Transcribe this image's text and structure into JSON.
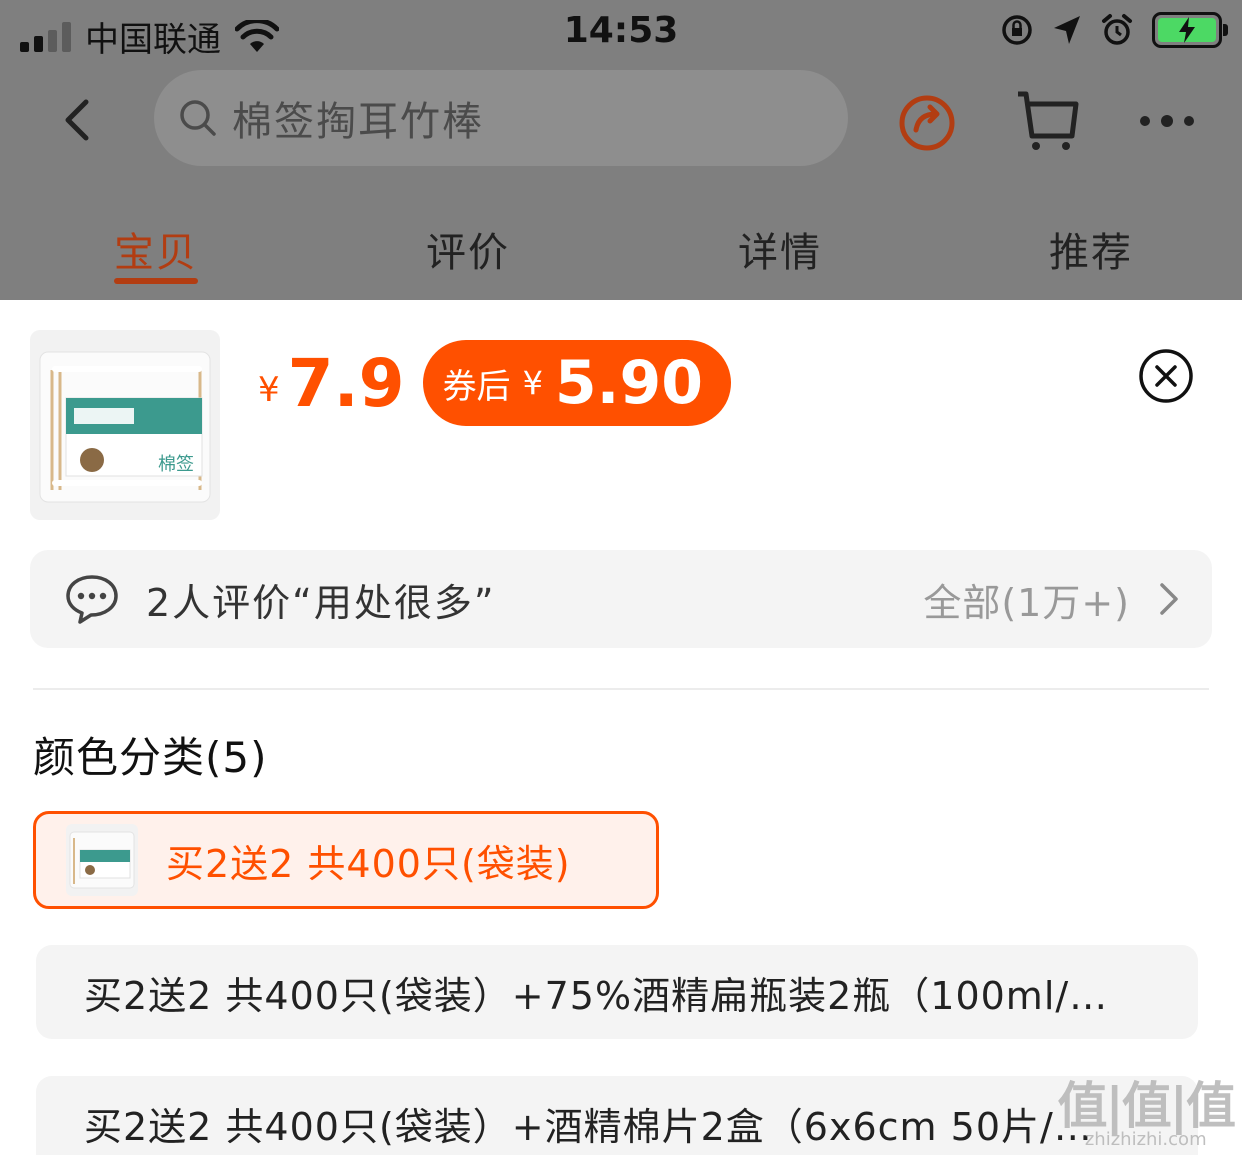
{
  "status_bar": {
    "carrier": "中国联通",
    "time": "14:53"
  },
  "search": {
    "placeholder": "棉签掏耳竹棒"
  },
  "tabs": [
    {
      "label": "宝贝",
      "active": true
    },
    {
      "label": "评价",
      "active": false
    },
    {
      "label": "详情",
      "active": false
    },
    {
      "label": "推荐",
      "active": false
    }
  ],
  "product": {
    "currency": "¥",
    "price": "7.9",
    "coupon_label": "券后",
    "coupon_currency": "¥",
    "coupon_price": "5.90",
    "thumb_text": "棉签"
  },
  "review": {
    "summary": "2人评价“用处很多”",
    "all_label": "全部(1万+)"
  },
  "sku": {
    "title": "颜色分类(5)",
    "options": [
      {
        "label": "买2送2 共400只(袋装)",
        "selected": true
      },
      {
        "label": "买2送2 共400只(袋装）+75%酒精扁瓶装2瓶（100ml/…",
        "selected": false
      },
      {
        "label": "买2送2 共400只(袋装）+酒精棉片2盒（6x6cm 50片/…",
        "selected": false
      }
    ]
  },
  "watermark": {
    "big": "值|值|值",
    "small": "zhizhizhi.com"
  },
  "colors": {
    "accent": "#ff5000",
    "tab_active": "#b23d12",
    "overlay": "#7f7f7f"
  }
}
